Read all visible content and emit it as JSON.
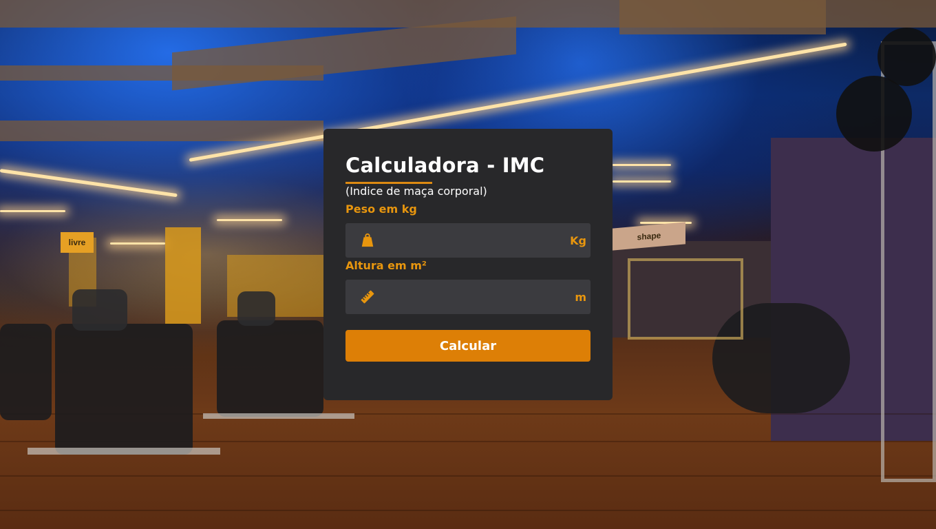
{
  "page": {
    "title": "Calculadora - IMC",
    "subtitle": "(Indice de maça corporal)"
  },
  "weight": {
    "label": "Peso em kg",
    "placeholder": "",
    "value": "",
    "unit": "Kg",
    "icon": "weight-icon"
  },
  "height": {
    "label": "Altura em m²",
    "placeholder": "",
    "value": "",
    "unit": "m",
    "icon": "ruler-icon"
  },
  "actions": {
    "calculate_label": "Calcular"
  },
  "colors": {
    "accent": "#dd7f06",
    "card_background": "#28282a",
    "input_background": "#3b3b3f",
    "label_color": "#e8960e"
  },
  "background": {
    "description_icon": "gym-background-image",
    "signs": [
      "livre",
      "shape"
    ]
  }
}
